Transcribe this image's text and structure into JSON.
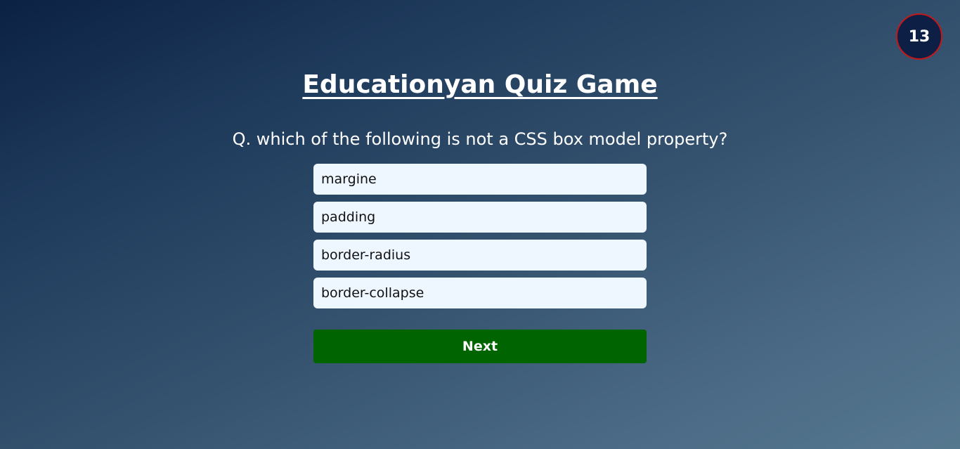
{
  "timer": {
    "value": "13",
    "colors": {
      "fill": "#0d1f45",
      "border": "#c41818"
    }
  },
  "title": "Educationyan Quiz Game",
  "question": "Q. which of the following is not a CSS box model property?",
  "options": [
    {
      "label": "margine"
    },
    {
      "label": "padding"
    },
    {
      "label": "border-radius"
    },
    {
      "label": "border-collapse"
    }
  ],
  "next_button": {
    "label": "Next",
    "color": "#006400"
  }
}
